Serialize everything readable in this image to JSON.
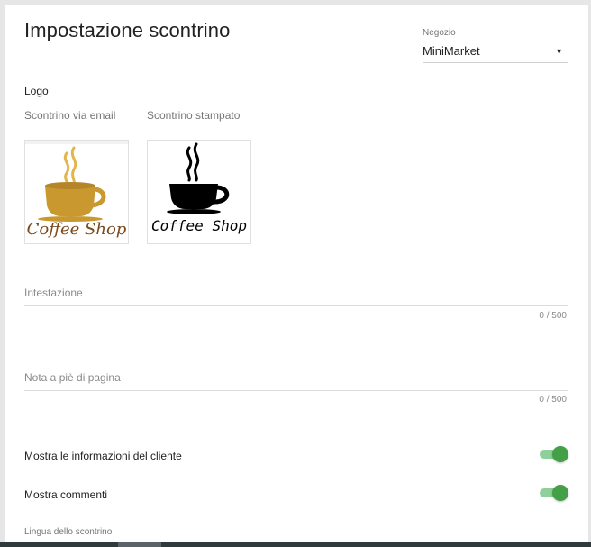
{
  "header": {
    "title": "Impostazione scontrino"
  },
  "store": {
    "label": "Negozio",
    "selected": "MiniMarket",
    "arrow": "▼"
  },
  "logo": {
    "label": "Logo",
    "email_label": "Scontrino via email",
    "printed_label": "Scontrino stampato",
    "email_logo_text": "Coffee Shop",
    "printed_logo_text": "Coffee Shop",
    "email_color": "#c9982e",
    "printed_color": "#000000"
  },
  "fields": {
    "header_label": "Intestazione",
    "header_counter": "0 / 500",
    "footer_label": "Nota a piè di pagina",
    "footer_counter": "0 / 500"
  },
  "toggles": {
    "customer_info_label": "Mostra le informazioni del cliente",
    "customer_info_on": true,
    "comments_label": "Mostra commenti",
    "comments_on": true,
    "accent_color": "#43a047"
  },
  "language": {
    "label": "Lingua dello scontrino"
  }
}
